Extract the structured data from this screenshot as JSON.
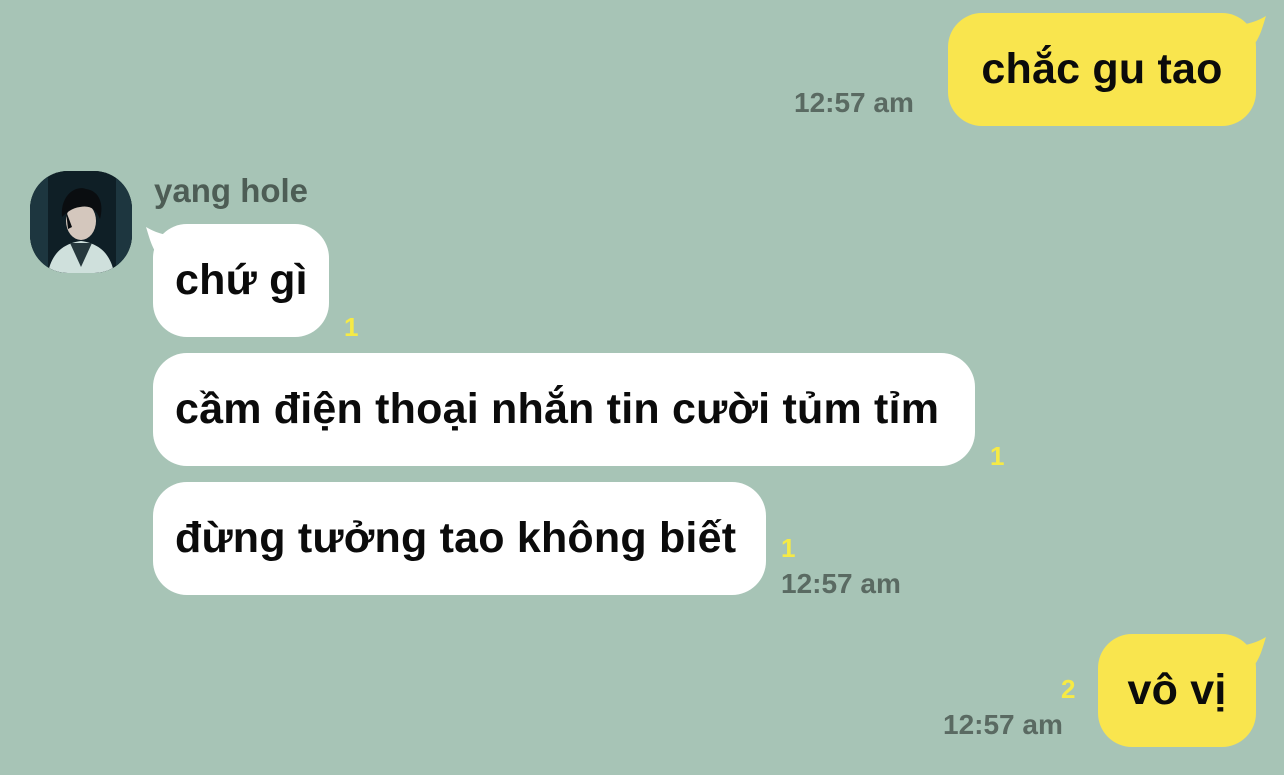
{
  "colors": {
    "background": "#a7c4b6",
    "my_bubble": "#f9e54e",
    "their_bubble": "#ffffff",
    "unread_count": "#f6ea45",
    "timestamp": "#5a6a62"
  },
  "chat": {
    "contact_name": "yang hole",
    "avatar_icon": "profile-photo-avatar",
    "messages": [
      {
        "from": "me",
        "text": "chắc gu tao",
        "time": "12:57 am",
        "unread": ""
      },
      {
        "from": "them",
        "text": "chứ gì",
        "time": "",
        "unread": "1"
      },
      {
        "from": "them",
        "text": "cầm điện thoại nhắn tin cười tủm tỉm",
        "time": "",
        "unread": "1"
      },
      {
        "from": "them",
        "text": "đừng tưởng tao không biết",
        "time": "12:57 am",
        "unread": "1"
      },
      {
        "from": "me",
        "text": "vô vị",
        "time": "12:57 am",
        "unread": "2"
      }
    ]
  }
}
